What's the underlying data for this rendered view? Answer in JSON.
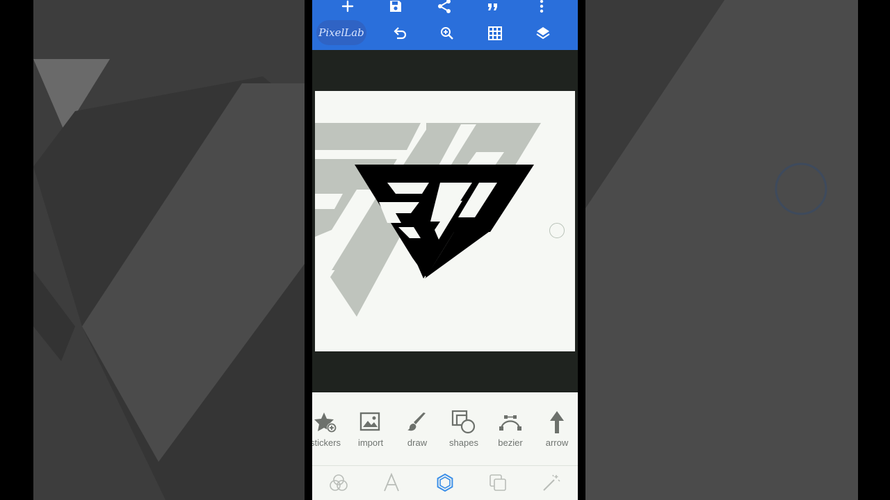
{
  "app": {
    "name": "PixelLab"
  },
  "toolbar": {
    "top_row": [
      {
        "icon": "add-icon"
      },
      {
        "icon": "save-icon"
      },
      {
        "icon": "share-icon"
      },
      {
        "icon": "quote-icon"
      },
      {
        "icon": "more-vert-icon"
      }
    ],
    "second_row": [
      {
        "icon": "undo-icon"
      },
      {
        "icon": "zoom-in-icon"
      },
      {
        "icon": "grid-icon"
      },
      {
        "icon": "layers-icon"
      }
    ],
    "accent_color": "#2a6fdb"
  },
  "canvas": {
    "background_color": "#f6f8f4",
    "logo_text": "SP",
    "logo_color": "#000000",
    "shadow_color": "#bfc4bd"
  },
  "tools": [
    {
      "label": "stickers",
      "icon": "sticker-add-icon"
    },
    {
      "label": "import",
      "icon": "image-import-icon"
    },
    {
      "label": "draw",
      "icon": "brush-icon"
    },
    {
      "label": "shapes",
      "icon": "shapes-icon"
    },
    {
      "label": "bezier",
      "icon": "bezier-icon"
    },
    {
      "label": "arrow",
      "icon": "arrow-up-icon"
    }
  ],
  "tabs": [
    {
      "icon": "blend-icon",
      "active": false
    },
    {
      "icon": "text-icon",
      "active": false
    },
    {
      "icon": "hexagon-icon",
      "active": true
    },
    {
      "icon": "layers-square-icon",
      "active": false
    },
    {
      "icon": "magic-wand-icon",
      "active": false
    }
  ]
}
